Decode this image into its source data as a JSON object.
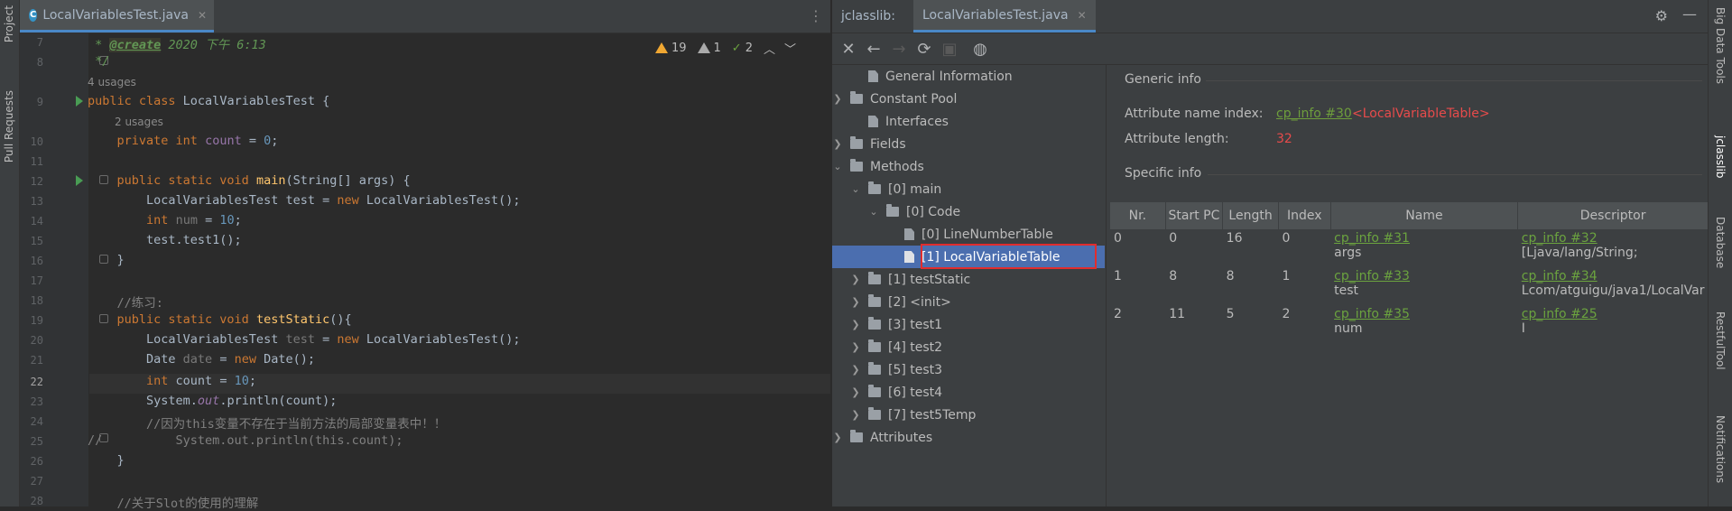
{
  "left_strip": {
    "project_label": "Project",
    "pull_requests_label": "Pull Requests"
  },
  "editor": {
    "tab_title": "LocalVariablesTest.java",
    "warnings": {
      "warn_count": "19",
      "weak_warn_count": "1",
      "typo_count": "2"
    },
    "usages_4": "4 usages",
    "usages_2": "2 usages",
    "lines": [
      "7",
      "8",
      "9",
      "10",
      "11",
      "12",
      "13",
      "14",
      "15",
      "16",
      "17",
      "18",
      "19",
      "20",
      "21",
      "22",
      "23",
      "24",
      "25",
      "26",
      "27",
      "28"
    ]
  },
  "jclasslib": {
    "label": "jclasslib:",
    "tab_title": "LocalVariablesTest.java",
    "tree": {
      "general": "General Information",
      "constant_pool": "Constant Pool",
      "interfaces": "Interfaces",
      "fields": "Fields",
      "methods": "Methods",
      "main": "[0] main",
      "code": "[0] Code",
      "lnt": "[0] LineNumberTable",
      "lvt": "[1] LocalVariableTable",
      "m1": "[1] testStatic",
      "m2": "[2] <init>",
      "m3": "[3] test1",
      "m4": "[4] test2",
      "m5": "[5] test3",
      "m6": "[6] test4",
      "m7": "[7] test5Temp",
      "attributes": "Attributes"
    },
    "details": {
      "generic_info": "Generic info",
      "attr_name_label": "Attribute name index:",
      "attr_name_link": "cp_info #30",
      "attr_name_value": "<LocalVariableTable>",
      "attr_len_label": "Attribute length:",
      "attr_len_value": "32",
      "specific_info": "Specific info",
      "columns": [
        "Nr.",
        "Start PC",
        "Length",
        "Index",
        "Name",
        "Descriptor"
      ],
      "rows": [
        {
          "nr": "0",
          "start_pc": "0",
          "length": "16",
          "index": "0",
          "name_link": "cp_info #31",
          "name": "args",
          "desc_link": "cp_info #32",
          "desc": "[Ljava/lang/String;"
        },
        {
          "nr": "1",
          "start_pc": "8",
          "length": "8",
          "index": "1",
          "name_link": "cp_info #33",
          "name": "test",
          "desc_link": "cp_info #34",
          "desc": "Lcom/atguigu/java1/LocalVar"
        },
        {
          "nr": "2",
          "start_pc": "11",
          "length": "5",
          "index": "2",
          "name_link": "cp_info #35",
          "name": "num",
          "desc_link": "cp_info #25",
          "desc": "I"
        }
      ]
    }
  },
  "right_strip": {
    "big_data": "Big Data Tools",
    "jclasslib": "jclasslib",
    "database": "Database",
    "restful": "RestfulTool",
    "notifications": "Notifications"
  }
}
